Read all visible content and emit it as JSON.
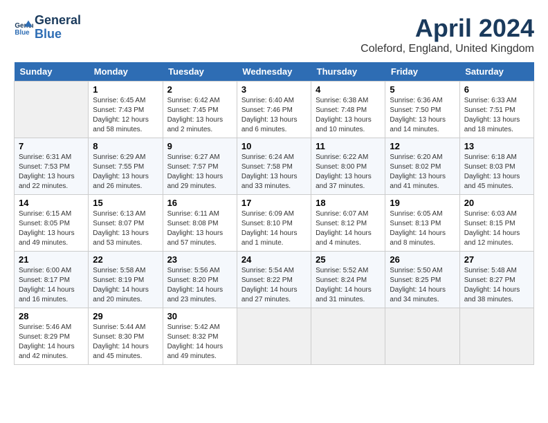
{
  "header": {
    "logo_line1": "General",
    "logo_line2": "Blue",
    "month": "April 2024",
    "location": "Coleford, England, United Kingdom"
  },
  "days_of_week": [
    "Sunday",
    "Monday",
    "Tuesday",
    "Wednesday",
    "Thursday",
    "Friday",
    "Saturday"
  ],
  "weeks": [
    [
      {
        "day": "",
        "sunrise": "",
        "sunset": "",
        "daylight": ""
      },
      {
        "day": "1",
        "sunrise": "Sunrise: 6:45 AM",
        "sunset": "Sunset: 7:43 PM",
        "daylight": "Daylight: 12 hours and 58 minutes."
      },
      {
        "day": "2",
        "sunrise": "Sunrise: 6:42 AM",
        "sunset": "Sunset: 7:45 PM",
        "daylight": "Daylight: 13 hours and 2 minutes."
      },
      {
        "day": "3",
        "sunrise": "Sunrise: 6:40 AM",
        "sunset": "Sunset: 7:46 PM",
        "daylight": "Daylight: 13 hours and 6 minutes."
      },
      {
        "day": "4",
        "sunrise": "Sunrise: 6:38 AM",
        "sunset": "Sunset: 7:48 PM",
        "daylight": "Daylight: 13 hours and 10 minutes."
      },
      {
        "day": "5",
        "sunrise": "Sunrise: 6:36 AM",
        "sunset": "Sunset: 7:50 PM",
        "daylight": "Daylight: 13 hours and 14 minutes."
      },
      {
        "day": "6",
        "sunrise": "Sunrise: 6:33 AM",
        "sunset": "Sunset: 7:51 PM",
        "daylight": "Daylight: 13 hours and 18 minutes."
      }
    ],
    [
      {
        "day": "7",
        "sunrise": "Sunrise: 6:31 AM",
        "sunset": "Sunset: 7:53 PM",
        "daylight": "Daylight: 13 hours and 22 minutes."
      },
      {
        "day": "8",
        "sunrise": "Sunrise: 6:29 AM",
        "sunset": "Sunset: 7:55 PM",
        "daylight": "Daylight: 13 hours and 26 minutes."
      },
      {
        "day": "9",
        "sunrise": "Sunrise: 6:27 AM",
        "sunset": "Sunset: 7:57 PM",
        "daylight": "Daylight: 13 hours and 29 minutes."
      },
      {
        "day": "10",
        "sunrise": "Sunrise: 6:24 AM",
        "sunset": "Sunset: 7:58 PM",
        "daylight": "Daylight: 13 hours and 33 minutes."
      },
      {
        "day": "11",
        "sunrise": "Sunrise: 6:22 AM",
        "sunset": "Sunset: 8:00 PM",
        "daylight": "Daylight: 13 hours and 37 minutes."
      },
      {
        "day": "12",
        "sunrise": "Sunrise: 6:20 AM",
        "sunset": "Sunset: 8:02 PM",
        "daylight": "Daylight: 13 hours and 41 minutes."
      },
      {
        "day": "13",
        "sunrise": "Sunrise: 6:18 AM",
        "sunset": "Sunset: 8:03 PM",
        "daylight": "Daylight: 13 hours and 45 minutes."
      }
    ],
    [
      {
        "day": "14",
        "sunrise": "Sunrise: 6:15 AM",
        "sunset": "Sunset: 8:05 PM",
        "daylight": "Daylight: 13 hours and 49 minutes."
      },
      {
        "day": "15",
        "sunrise": "Sunrise: 6:13 AM",
        "sunset": "Sunset: 8:07 PM",
        "daylight": "Daylight: 13 hours and 53 minutes."
      },
      {
        "day": "16",
        "sunrise": "Sunrise: 6:11 AM",
        "sunset": "Sunset: 8:08 PM",
        "daylight": "Daylight: 13 hours and 57 minutes."
      },
      {
        "day": "17",
        "sunrise": "Sunrise: 6:09 AM",
        "sunset": "Sunset: 8:10 PM",
        "daylight": "Daylight: 14 hours and 1 minute."
      },
      {
        "day": "18",
        "sunrise": "Sunrise: 6:07 AM",
        "sunset": "Sunset: 8:12 PM",
        "daylight": "Daylight: 14 hours and 4 minutes."
      },
      {
        "day": "19",
        "sunrise": "Sunrise: 6:05 AM",
        "sunset": "Sunset: 8:13 PM",
        "daylight": "Daylight: 14 hours and 8 minutes."
      },
      {
        "day": "20",
        "sunrise": "Sunrise: 6:03 AM",
        "sunset": "Sunset: 8:15 PM",
        "daylight": "Daylight: 14 hours and 12 minutes."
      }
    ],
    [
      {
        "day": "21",
        "sunrise": "Sunrise: 6:00 AM",
        "sunset": "Sunset: 8:17 PM",
        "daylight": "Daylight: 14 hours and 16 minutes."
      },
      {
        "day": "22",
        "sunrise": "Sunrise: 5:58 AM",
        "sunset": "Sunset: 8:19 PM",
        "daylight": "Daylight: 14 hours and 20 minutes."
      },
      {
        "day": "23",
        "sunrise": "Sunrise: 5:56 AM",
        "sunset": "Sunset: 8:20 PM",
        "daylight": "Daylight: 14 hours and 23 minutes."
      },
      {
        "day": "24",
        "sunrise": "Sunrise: 5:54 AM",
        "sunset": "Sunset: 8:22 PM",
        "daylight": "Daylight: 14 hours and 27 minutes."
      },
      {
        "day": "25",
        "sunrise": "Sunrise: 5:52 AM",
        "sunset": "Sunset: 8:24 PM",
        "daylight": "Daylight: 14 hours and 31 minutes."
      },
      {
        "day": "26",
        "sunrise": "Sunrise: 5:50 AM",
        "sunset": "Sunset: 8:25 PM",
        "daylight": "Daylight: 14 hours and 34 minutes."
      },
      {
        "day": "27",
        "sunrise": "Sunrise: 5:48 AM",
        "sunset": "Sunset: 8:27 PM",
        "daylight": "Daylight: 14 hours and 38 minutes."
      }
    ],
    [
      {
        "day": "28",
        "sunrise": "Sunrise: 5:46 AM",
        "sunset": "Sunset: 8:29 PM",
        "daylight": "Daylight: 14 hours and 42 minutes."
      },
      {
        "day": "29",
        "sunrise": "Sunrise: 5:44 AM",
        "sunset": "Sunset: 8:30 PM",
        "daylight": "Daylight: 14 hours and 45 minutes."
      },
      {
        "day": "30",
        "sunrise": "Sunrise: 5:42 AM",
        "sunset": "Sunset: 8:32 PM",
        "daylight": "Daylight: 14 hours and 49 minutes."
      },
      {
        "day": "",
        "sunrise": "",
        "sunset": "",
        "daylight": ""
      },
      {
        "day": "",
        "sunrise": "",
        "sunset": "",
        "daylight": ""
      },
      {
        "day": "",
        "sunrise": "",
        "sunset": "",
        "daylight": ""
      },
      {
        "day": "",
        "sunrise": "",
        "sunset": "",
        "daylight": ""
      }
    ]
  ]
}
